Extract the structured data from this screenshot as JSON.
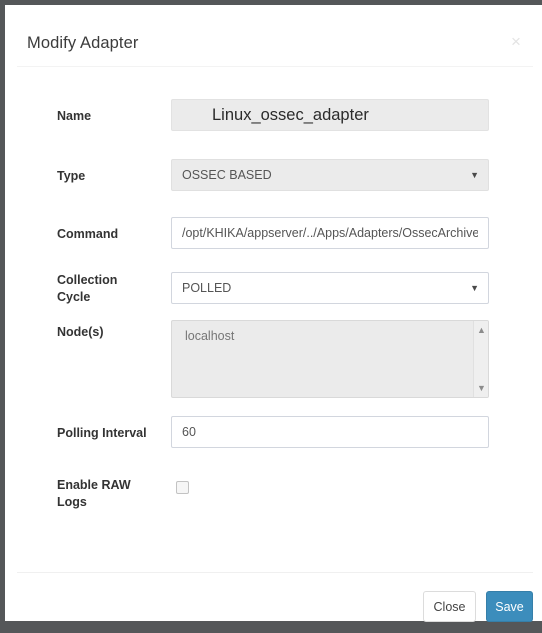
{
  "dialog": {
    "title": "Modify Adapter",
    "close_icon_label": "×"
  },
  "form": {
    "fields": [
      {
        "label": "Name",
        "type": "text",
        "value": "Linux_ossec_adapter",
        "placeholder": "",
        "disabled": true
      },
      {
        "label": "Type",
        "type": "select",
        "value": "OSSEC BASED",
        "caret": "▼",
        "disabled": true
      },
      {
        "label": "Command",
        "type": "text",
        "value": "/opt/KHIKA/appserver/../Apps/Adapters/OssecArchiveLo",
        "placeholder": "",
        "disabled": false
      },
      {
        "label": "Collection Cycle",
        "label_line1": "Collection",
        "label_line2": "Cycle",
        "type": "select",
        "value": "POLLED",
        "caret": "▼",
        "disabled": false
      },
      {
        "label": "Node(s)",
        "type": "multiselect",
        "value": "localhost",
        "scroll_up_icon": "▲",
        "scroll_down_icon": "▼",
        "disabled": true
      },
      {
        "label": "Polling Interval",
        "type": "text",
        "value": "60",
        "placeholder": "",
        "disabled": false
      },
      {
        "label": "Enable RAW Logs",
        "label_line1": "Enable RAW",
        "label_line2": "Logs",
        "type": "checkbox",
        "checked": false
      }
    ]
  },
  "footer": {
    "close_label": "Close",
    "save_label": "Save"
  },
  "colors": {
    "accent": "#3c8dbc",
    "backdrop": "#555759",
    "disabled_field": "#ebebeb",
    "border": "#d2d6de"
  }
}
